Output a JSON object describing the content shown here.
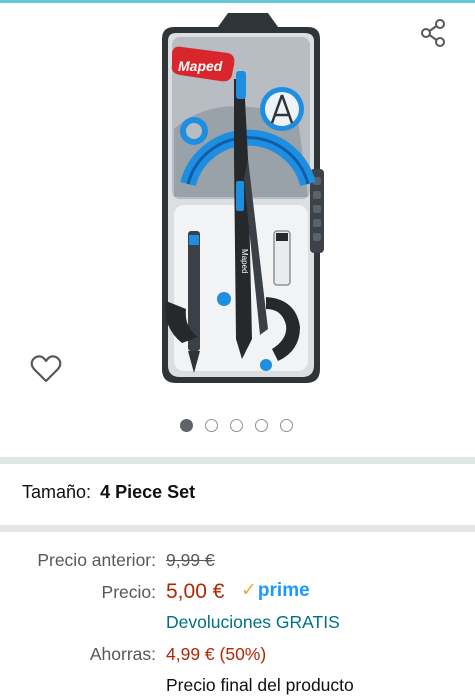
{
  "product": {
    "brand_logo": "Maped",
    "image_alt": "Maped compass set"
  },
  "gallery": {
    "dots": [
      {
        "active": true
      },
      {
        "active": false
      },
      {
        "active": false
      },
      {
        "active": false
      },
      {
        "active": false
      }
    ]
  },
  "icons": {
    "share": "share-icon",
    "wishlist": "heart-icon"
  },
  "size": {
    "label": "Tamaño:",
    "value": "4 Piece Set"
  },
  "pricing": {
    "previous_label": "Precio anterior:",
    "previous_value": "9,99 €",
    "price_label": "Precio:",
    "price_value": "5,00 €",
    "prime_label": "prime",
    "returns_text": "Devoluciones GRATIS",
    "savings_label": "Ahorras:",
    "savings_value": "4,99 € (50%)",
    "final_text": "Precio final del producto"
  },
  "colors": {
    "price": "#b12704",
    "link": "#007185",
    "prime": "#1a98ff",
    "accent": "#64c8d6"
  }
}
